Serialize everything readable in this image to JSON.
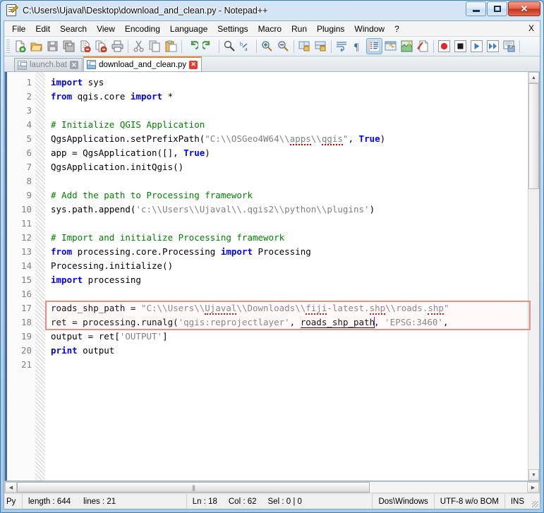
{
  "window": {
    "title": "C:\\Users\\Ujaval\\Desktop\\download_and_clean.py - Notepad++",
    "app_icon": "notepad-plus-plus-icon",
    "minimize_label": "",
    "maximize_label": "",
    "close_label": "✕"
  },
  "menubar": {
    "items": [
      {
        "label": "File"
      },
      {
        "label": "Edit"
      },
      {
        "label": "Search"
      },
      {
        "label": "View"
      },
      {
        "label": "Encoding"
      },
      {
        "label": "Language"
      },
      {
        "label": "Settings"
      },
      {
        "label": "Macro"
      },
      {
        "label": "Run"
      },
      {
        "label": "Plugins"
      },
      {
        "label": "Window"
      },
      {
        "label": "?"
      }
    ],
    "close_document": "X"
  },
  "toolbar": {
    "buttons": [
      {
        "name": "new-file-icon",
        "tooltip": "New"
      },
      {
        "name": "open-file-icon",
        "tooltip": "Open"
      },
      {
        "name": "save-icon",
        "tooltip": "Save"
      },
      {
        "name": "save-all-icon",
        "tooltip": "Save All"
      },
      {
        "name": "close-file-icon",
        "tooltip": "Close"
      },
      {
        "name": "close-all-icon",
        "tooltip": "Close All"
      },
      {
        "name": "print-icon",
        "tooltip": "Print"
      },
      {
        "name": "cut-icon",
        "tooltip": "Cut"
      },
      {
        "name": "copy-icon",
        "tooltip": "Copy"
      },
      {
        "name": "paste-icon",
        "tooltip": "Paste"
      },
      {
        "name": "undo-icon",
        "tooltip": "Undo"
      },
      {
        "name": "redo-icon",
        "tooltip": "Redo"
      },
      {
        "name": "find-icon",
        "tooltip": "Find"
      },
      {
        "name": "replace-icon",
        "tooltip": "Replace"
      },
      {
        "name": "zoom-in-icon",
        "tooltip": "Zoom In"
      },
      {
        "name": "zoom-out-icon",
        "tooltip": "Zoom Out"
      },
      {
        "name": "sync-vertical-scroll-icon",
        "tooltip": "Synchronize Vertical Scrolling"
      },
      {
        "name": "sync-horizontal-scroll-icon",
        "tooltip": "Synchronize Horizontal Scrolling"
      },
      {
        "name": "word-wrap-icon",
        "tooltip": "Word Wrap"
      },
      {
        "name": "show-all-characters-icon",
        "tooltip": "Show All Characters"
      },
      {
        "name": "show-indent-guide-icon",
        "tooltip": "Show Indent Guide"
      },
      {
        "name": "user-defined-dialog-icon",
        "tooltip": "User Defined Dialogue"
      },
      {
        "name": "document-map-icon",
        "tooltip": "Document Map"
      },
      {
        "name": "function-list-icon",
        "tooltip": "Function List"
      },
      {
        "name": "record-macro-icon",
        "tooltip": "Start Recording"
      },
      {
        "name": "stop-macro-icon",
        "tooltip": "Stop Recording"
      },
      {
        "name": "play-macro-icon",
        "tooltip": "Playback"
      },
      {
        "name": "run-macro-multiple-icon",
        "tooltip": "Run a Macro Multiple Times"
      },
      {
        "name": "save-macro-icon",
        "tooltip": "Save Current Recorded Macro"
      }
    ]
  },
  "tabs": [
    {
      "label": "launch.bat",
      "active": false,
      "icon": "saved-file-icon",
      "close": "✕"
    },
    {
      "label": "download_and_clean.py",
      "active": true,
      "icon": "saved-file-icon",
      "close": "✕"
    }
  ],
  "editor": {
    "line_numbers": [
      "1",
      "2",
      "3",
      "4",
      "5",
      "6",
      "7",
      "8",
      "9",
      "10",
      "11",
      "12",
      "13",
      "14",
      "15",
      "16",
      "17",
      "18",
      "19",
      "20",
      "21"
    ],
    "lines": [
      {
        "n": 1,
        "tokens": [
          {
            "t": "import",
            "c": "kw"
          },
          {
            "t": " sys",
            "c": "plain"
          }
        ]
      },
      {
        "n": 2,
        "tokens": [
          {
            "t": "from",
            "c": "kw"
          },
          {
            "t": " qgis.core ",
            "c": "plain"
          },
          {
            "t": "import",
            "c": "kw"
          },
          {
            "t": " ",
            "c": "plain"
          },
          {
            "t": "*",
            "c": "op"
          }
        ]
      },
      {
        "n": 3,
        "tokens": []
      },
      {
        "n": 4,
        "tokens": [
          {
            "t": "# Initialize QGIS Application",
            "c": "com"
          }
        ]
      },
      {
        "n": 5,
        "tokens": [
          {
            "t": "QgsApplication.setPrefixPath",
            "c": "plain"
          },
          {
            "t": "(",
            "c": "op"
          },
          {
            "t": "\"C:\\\\OSGeo4W64\\\\",
            "c": "str"
          },
          {
            "t": "apps",
            "c": "str misspell"
          },
          {
            "t": "\\\\",
            "c": "str"
          },
          {
            "t": "qgis",
            "c": "str misspell"
          },
          {
            "t": "\"",
            "c": "str"
          },
          {
            "t": ", ",
            "c": "op"
          },
          {
            "t": "True",
            "c": "kw"
          },
          {
            "t": ")",
            "c": "op"
          }
        ]
      },
      {
        "n": 6,
        "tokens": [
          {
            "t": "app = QgsApplication",
            "c": "plain"
          },
          {
            "t": "([], ",
            "c": "op"
          },
          {
            "t": "True",
            "c": "kw"
          },
          {
            "t": ")",
            "c": "op"
          }
        ]
      },
      {
        "n": 7,
        "tokens": [
          {
            "t": "QgsApplication.initQgis",
            "c": "plain"
          },
          {
            "t": "()",
            "c": "op"
          }
        ]
      },
      {
        "n": 8,
        "tokens": []
      },
      {
        "n": 9,
        "tokens": [
          {
            "t": "# Add the path to Processing framework",
            "c": "com"
          }
        ]
      },
      {
        "n": 10,
        "tokens": [
          {
            "t": "sys.path.append",
            "c": "plain"
          },
          {
            "t": "(",
            "c": "op"
          },
          {
            "t": "'c:\\\\Users\\\\Ujaval\\\\.qgis2\\\\python\\\\plugins'",
            "c": "str"
          },
          {
            "t": ")",
            "c": "op"
          }
        ]
      },
      {
        "n": 11,
        "tokens": []
      },
      {
        "n": 12,
        "tokens": [
          {
            "t": "# Import and initialize Processing framework",
            "c": "com"
          }
        ]
      },
      {
        "n": 13,
        "tokens": [
          {
            "t": "from",
            "c": "kw"
          },
          {
            "t": " processing.core.Processing ",
            "c": "plain"
          },
          {
            "t": "import",
            "c": "kw"
          },
          {
            "t": " Processing",
            "c": "plain"
          }
        ]
      },
      {
        "n": 14,
        "tokens": [
          {
            "t": "Processing.initialize",
            "c": "plain"
          },
          {
            "t": "()",
            "c": "op"
          }
        ]
      },
      {
        "n": 15,
        "tokens": [
          {
            "t": "import",
            "c": "kw"
          },
          {
            "t": " processing",
            "c": "plain"
          }
        ]
      },
      {
        "n": 16,
        "tokens": []
      },
      {
        "n": 17,
        "tokens": [
          {
            "t": "roads_shp_path = ",
            "c": "plain"
          },
          {
            "t": "\"C:\\\\Users\\\\",
            "c": "str"
          },
          {
            "t": "Ujaval",
            "c": "str misspell"
          },
          {
            "t": "\\\\Downloads\\\\",
            "c": "str"
          },
          {
            "t": "fiji",
            "c": "str misspell"
          },
          {
            "t": "-latest.",
            "c": "str"
          },
          {
            "t": "shp",
            "c": "str misspell"
          },
          {
            "t": "\\\\roads.",
            "c": "str"
          },
          {
            "t": "shp",
            "c": "str misspell"
          },
          {
            "t": "\"",
            "c": "str"
          }
        ]
      },
      {
        "n": 18,
        "tokens": [
          {
            "t": "ret = processing.runalg",
            "c": "plain"
          },
          {
            "t": "(",
            "c": "op"
          },
          {
            "t": "'qgis:reprojectlayer'",
            "c": "str"
          },
          {
            "t": ", ",
            "c": "op"
          },
          {
            "t": "roads_shp_path",
            "c": "plain occur"
          },
          {
            "t": "CARET",
            "c": "caret"
          },
          {
            "t": ", ",
            "c": "op"
          },
          {
            "t": "'EPSG:3460'",
            "c": "str"
          },
          {
            "t": ",",
            "c": "op"
          }
        ]
      },
      {
        "n": 19,
        "tokens": [
          {
            "t": "output = ret",
            "c": "plain"
          },
          {
            "t": "[",
            "c": "op"
          },
          {
            "t": "'OUTPUT'",
            "c": "str"
          },
          {
            "t": "]",
            "c": "op"
          }
        ]
      },
      {
        "n": 20,
        "tokens": [
          {
            "t": "print",
            "c": "kw"
          },
          {
            "t": " output",
            "c": "plain"
          }
        ]
      },
      {
        "n": 21,
        "tokens": []
      }
    ],
    "highlight_box": {
      "from_line": 17,
      "to_line": 18,
      "color": "#e88d87"
    },
    "colors": {
      "keyword": "#0000ff",
      "comment": "#008000",
      "string": "#808080",
      "plain": "#000000",
      "misspell_underline": "#d00000",
      "caret": "#8000c0"
    },
    "scrollbars": {
      "vertical_up": "▲",
      "vertical_down": "▼",
      "horizontal_left": "◀",
      "horizontal_right": "▶",
      "h_thumb_grip": "|||"
    }
  },
  "statusbar": {
    "language": "Py",
    "length_label": "length : 644",
    "lines_label": "lines : 21",
    "ln_label": "Ln : 18",
    "col_label": "Col : 62",
    "sel_label": "Sel : 0 | 0",
    "eol": "Dos\\Windows",
    "encoding": "UTF-8 w/o BOM",
    "insert_mode": "INS"
  }
}
